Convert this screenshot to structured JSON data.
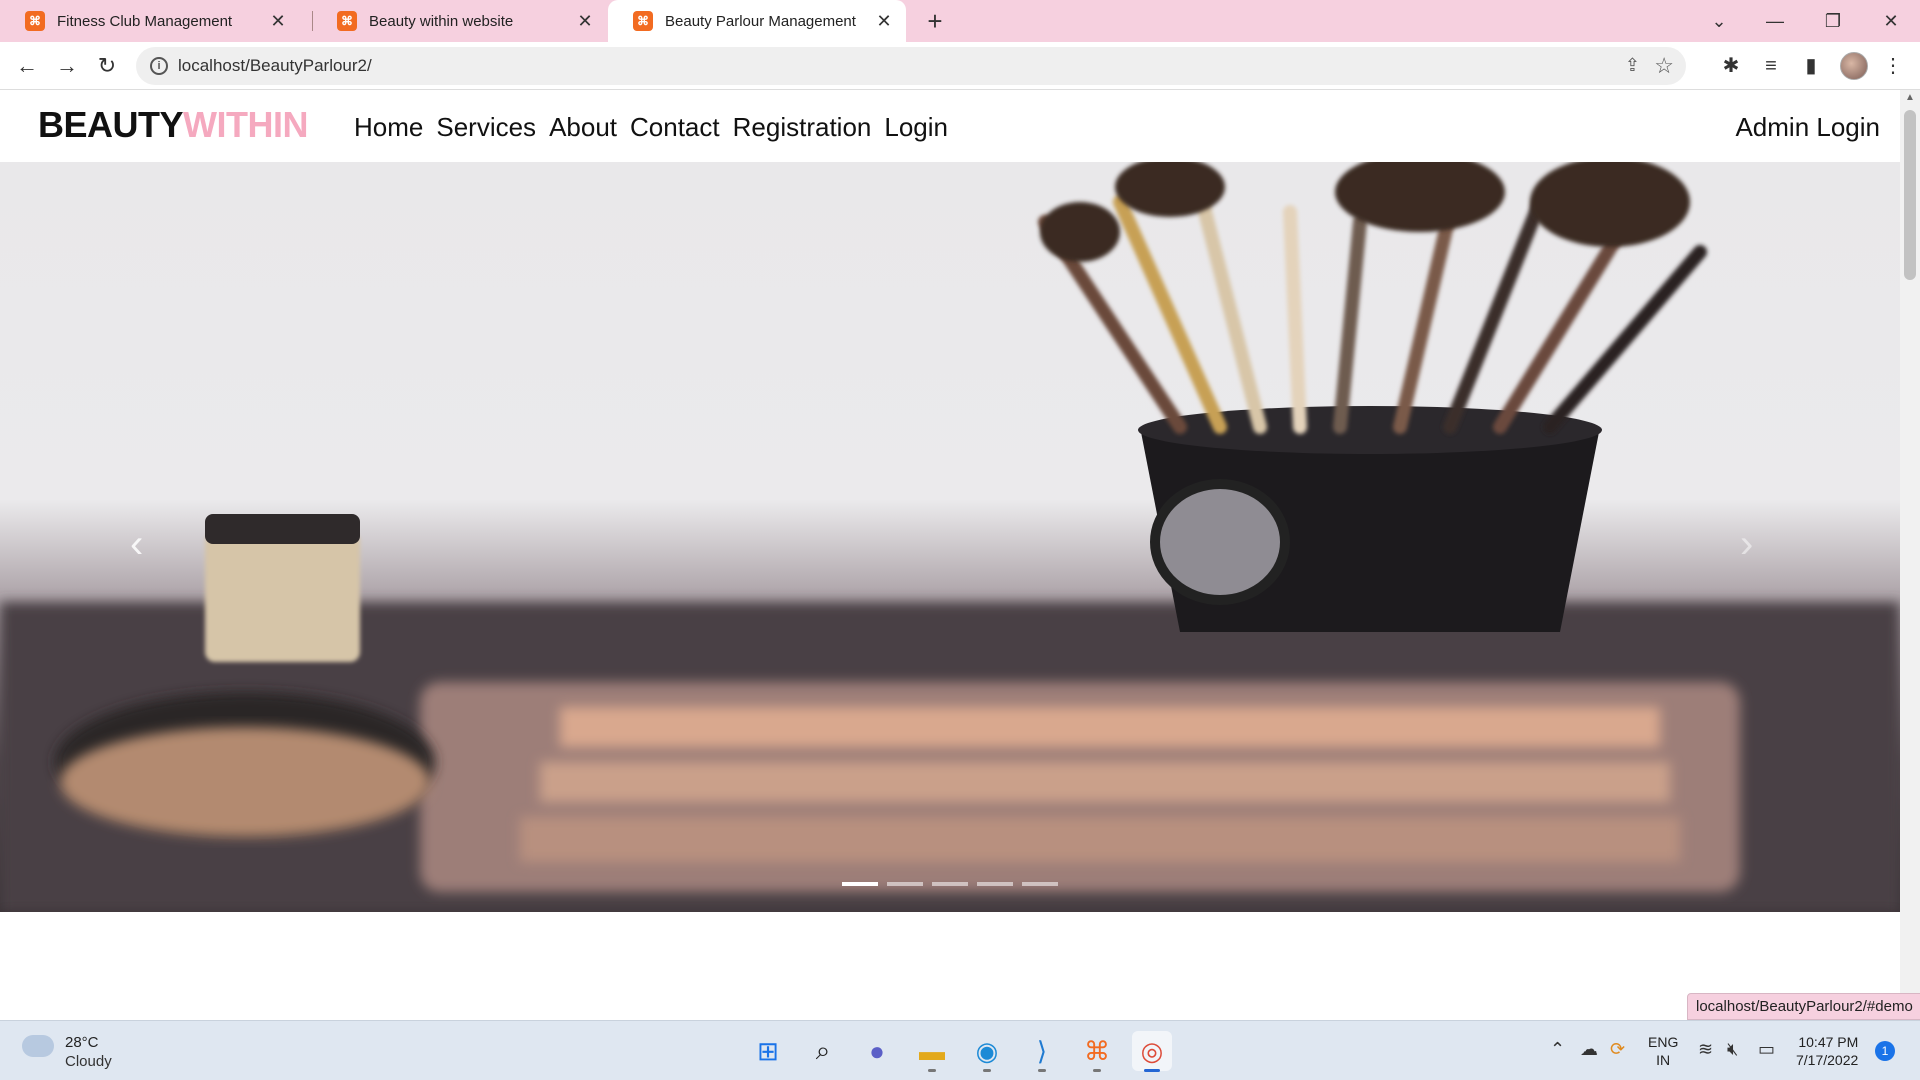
{
  "browser": {
    "tabs": [
      {
        "title": "Fitness Club Management",
        "active": false
      },
      {
        "title": "Beauty within website",
        "active": false
      },
      {
        "title": "Beauty Parlour Management",
        "active": true
      }
    ],
    "close_glyph": "✕",
    "new_tab_glyph": "+",
    "url": "localhost/BeautyParlour2/",
    "status_url": "localhost/BeautyParlour2/#demo"
  },
  "site": {
    "brand_part1": "BEAUTY",
    "brand_part2": "WITHIN",
    "brand_accent_color": "#f5a9bf",
    "nav_items": [
      "Home",
      "Services",
      "About",
      "Contact",
      "Registration",
      "Login"
    ],
    "admin_label": "Admin Login"
  },
  "carousel": {
    "slides": 5,
    "active_slide": 1,
    "prev_icon": "chevron-left-icon",
    "next_icon": "chevron-right-icon"
  },
  "taskbar": {
    "weather_temp": "28°C",
    "weather_condition": "Cloudy",
    "lang_line1": "ENG",
    "lang_line2": "IN",
    "time": "10:47 PM",
    "date": "7/17/2022",
    "notification_count": "1"
  }
}
